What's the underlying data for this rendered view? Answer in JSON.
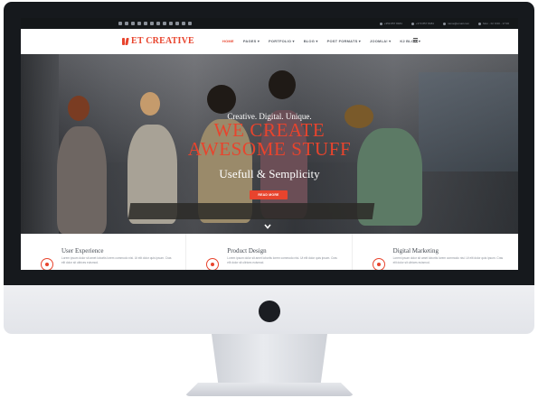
{
  "topbar": {
    "social_icons": [
      "facebook-icon",
      "twitter-icon",
      "google-plus-icon",
      "linkedin-icon",
      "pinterest-icon",
      "youtube-icon",
      "instagram-icon",
      "dribbble-icon",
      "flickr-icon",
      "vimeo-icon",
      "rss-icon",
      "skype-icon"
    ],
    "phone_1": "+359 857 8484",
    "phone_2": "+373 857 8484",
    "email": "name@email.com",
    "hours": "Mon - Fri 9:00 - 17:00"
  },
  "navbar": {
    "logo": "ET CREATIVE",
    "menu": [
      "HOME",
      "PAGES ▾",
      "PORTFOLIO ▾",
      "BLOG ▾",
      "POST FORMATS ▾",
      "JOOMLA! ▾",
      "K2 BLOG ▾"
    ]
  },
  "hero": {
    "tagline": "Creative. Digital. Unique.",
    "headline_line1": "WE CREATE",
    "headline_line2": "AWESOME STUFF",
    "subline": "Usefull & Semplicity",
    "button": "READ MORE"
  },
  "features": [
    {
      "title": "User Experience",
      "body": "Lorem ipsum dolor sit amet lobortis lorem commodo nisi. Ut elit dolor quis ipsum. Cras elit dolor sit ultrices euismod."
    },
    {
      "title": "Product Design",
      "body": "Lorem ipsum dolor sit amet lobortis lorem commodo nisi. Ut elit dolor quis ipsum. Cras elit dolor sit ultrices euismod."
    },
    {
      "title": "Digital Marketing",
      "body": "Lorem ipsum dolor sit amet lobortis lorem commodo nisi. Ut elit dolor quis ipsum. Cras elit dolor sit ultrices euismod."
    }
  ],
  "colors": {
    "accent": "#e8442d",
    "topbar": "#141719",
    "bezel": "#16191d"
  }
}
